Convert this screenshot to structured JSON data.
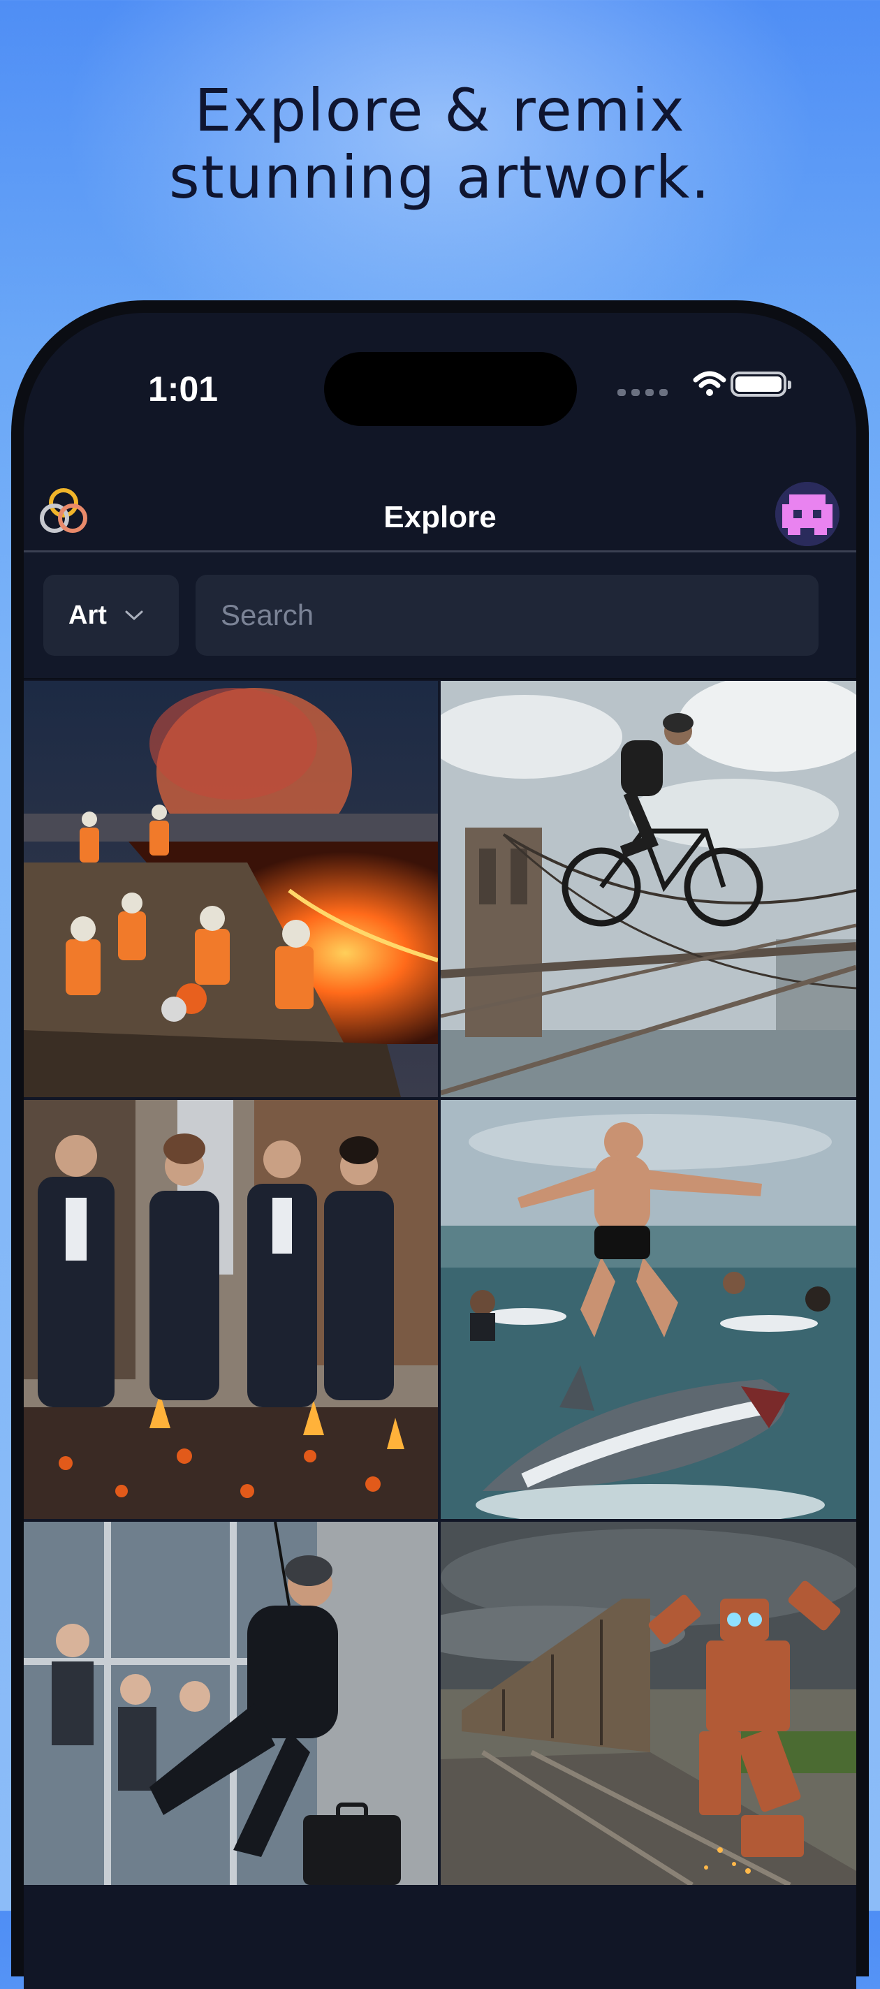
{
  "headline": {
    "line1": "Explore & remix",
    "line2": "stunning artwork."
  },
  "status_bar": {
    "time": "1:01"
  },
  "nav": {
    "title": "Explore",
    "logo_icon": "rings-logo-icon",
    "avatar_icon": "pixel-robot-avatar"
  },
  "filters": {
    "category": "Art",
    "search_placeholder": "Search"
  },
  "gallery": {
    "items": [
      {
        "subject": "construction workers beside lava"
      },
      {
        "subject": "cyclist on bridge cables"
      },
      {
        "subject": "office workers walking on hot coals"
      },
      {
        "subject": "man surfing on a shark"
      },
      {
        "subject": "window washer in suit with briefcase"
      },
      {
        "subject": "robot beside train"
      }
    ]
  },
  "colors": {
    "accent_gold": "#f1b52a",
    "accent_coral": "#e98a6a",
    "avatar_pink": "#e983f0"
  }
}
